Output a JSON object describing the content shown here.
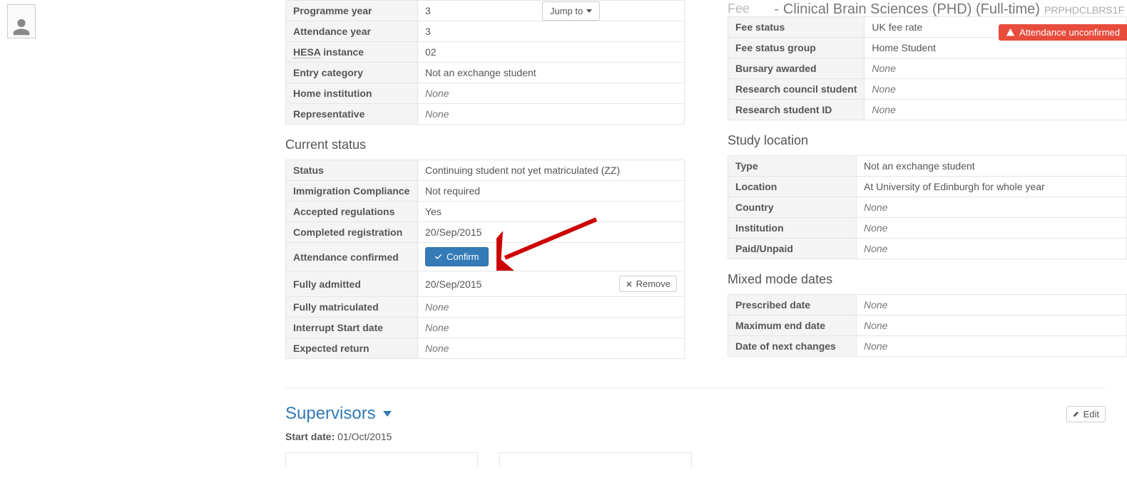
{
  "header": {
    "prefix_dash": "-",
    "programme": "Clinical Brain Sciences (PHD) (Full-time)",
    "code": "PRPHDCLBRS1F"
  },
  "alert": {
    "text": "Attendance unconfirmed"
  },
  "jumpto": {
    "label": "Jump to"
  },
  "programme_details": {
    "programme_year": {
      "label": "Programme year",
      "value": "3"
    },
    "attendance_year": {
      "label": "Attendance year",
      "value": "3"
    },
    "hesa_instance": {
      "label_prefix": "HESA",
      "label_suffix": " instance",
      "value": "02"
    },
    "entry_category": {
      "label": "Entry category",
      "value": "Not an exchange student"
    },
    "home_institution": {
      "label": "Home institution",
      "value": "None"
    },
    "representative": {
      "label": "Representative",
      "value": "None"
    }
  },
  "current_status_heading": "Current status",
  "current_status": {
    "status": {
      "label": "Status",
      "value": "Continuing student not yet matriculated (ZZ)"
    },
    "immigration": {
      "label": "Immigration Compliance",
      "value": "Not required"
    },
    "accepted_regs": {
      "label": "Accepted regulations",
      "value": "Yes"
    },
    "completed_reg": {
      "label": "Completed registration",
      "value": "20/Sep/2015"
    },
    "attendance_confirmed": {
      "label": "Attendance confirmed",
      "confirm_btn": "Confirm"
    },
    "fully_admitted": {
      "label": "Fully admitted",
      "value": "20/Sep/2015",
      "remove_btn": "Remove"
    },
    "fully_matriculated": {
      "label": "Fully matriculated",
      "value": "None"
    },
    "interrupt_start": {
      "label": "Interrupt Start date",
      "value": "None"
    },
    "expected_return": {
      "label": "Expected return",
      "value": "None"
    }
  },
  "fees_heading_partial": "Fee",
  "fees": {
    "fee_status": {
      "label": "Fee status",
      "value": "UK fee rate"
    },
    "fee_status_group": {
      "label": "Fee status group",
      "value": "Home Student"
    },
    "bursary": {
      "label": "Bursary awarded",
      "value": "None"
    },
    "research_council": {
      "label": "Research council student",
      "value": "None"
    },
    "research_id": {
      "label": "Research student ID",
      "value": "None"
    }
  },
  "study_location_heading": "Study location",
  "study_location": {
    "type": {
      "label": "Type",
      "value": "Not an exchange student"
    },
    "location": {
      "label": "Location",
      "value": "At University of Edinburgh for whole year"
    },
    "country": {
      "label": "Country",
      "value": "None"
    },
    "institution": {
      "label": "Institution",
      "value": "None"
    },
    "paid": {
      "label": "Paid/Unpaid",
      "value": "None"
    }
  },
  "mixed_mode_heading": "Mixed mode dates",
  "mixed_mode": {
    "prescribed": {
      "label": "Prescribed date",
      "value": "None"
    },
    "max_end": {
      "label": "Maximum end date",
      "value": "None"
    },
    "next_changes": {
      "label": "Date of next changes",
      "value": "None"
    }
  },
  "supervisors": {
    "heading": "Supervisors",
    "edit_btn": "Edit",
    "start_date_label": "Start date:",
    "start_date_value": "01/Oct/2015"
  }
}
